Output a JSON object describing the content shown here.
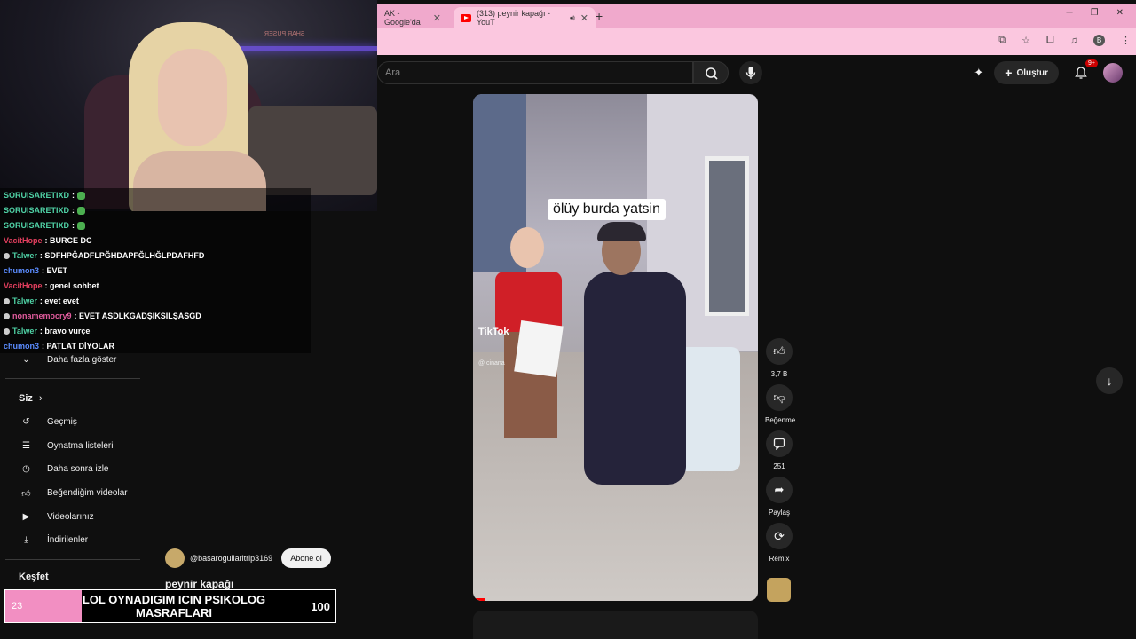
{
  "browser": {
    "tabs": [
      {
        "title": "AK - Google'da"
      },
      {
        "title": "(313) peynir kapağı - YouT"
      }
    ],
    "new_tab": "+",
    "profile_letter": "B"
  },
  "header": {
    "search_placeholder": "Ara",
    "create_label": "Oluştur",
    "notif_count": "9+"
  },
  "chat": {
    "messages": [
      {
        "user": "SORUISARETIXD",
        "text": ":",
        "color": "#4fd1a5",
        "emote": true
      },
      {
        "user": "SORUISARETIXD",
        "text": ":",
        "color": "#4fd1a5",
        "emote": true
      },
      {
        "user": "SORUISARETIXD",
        "text": ":",
        "color": "#4fd1a5",
        "emote": true
      },
      {
        "user": "VacitHope",
        "text": ": BURCE DC",
        "color": "#e33f5e",
        "emote": false
      },
      {
        "user": "Talwer",
        "text": ": SDFHPĞADFLPĞHDAPFĞLHĞLPDAFHFD",
        "color": "#4fd1a5",
        "emote": false
      },
      {
        "user": "chumon3",
        "text": ": EVET",
        "color": "#5b8cff",
        "emote": false
      },
      {
        "user": "VacitHope",
        "text": ": genel sohbet",
        "color": "#e33f5e",
        "emote": false
      },
      {
        "user": "Talwer",
        "text": ": evet evet",
        "color": "#4fd1a5",
        "emote": false
      },
      {
        "user": "nonamemocry9",
        "text": ": EVET ASDLKGADŞIKSİLŞASGD",
        "color": "#e35c9e",
        "emote": false
      },
      {
        "user": "Talwer",
        "text": ": bravo vurçe",
        "color": "#4fd1a5",
        "emote": false
      },
      {
        "user": "chumon3",
        "text": ": PATLAT DİYOLAR",
        "color": "#5b8cff",
        "emote": false
      }
    ]
  },
  "sidebar": {
    "show_more": "Daha fazla göster",
    "you_header": "Siz",
    "items": [
      {
        "label": "Geçmiş",
        "icon": "history-icon"
      },
      {
        "label": "Oynatma listeleri",
        "icon": "playlist-icon"
      },
      {
        "label": "Daha sonra izle",
        "icon": "clock-icon"
      },
      {
        "label": "Beğendiğim videolar",
        "icon": "thumb-up-icon"
      },
      {
        "label": "Videolarınız",
        "icon": "video-icon"
      },
      {
        "label": "İndirilenler",
        "icon": "download-icon"
      }
    ],
    "explore_header": "Keşfet"
  },
  "video": {
    "caption": "ölüy burda yatsin",
    "watermark": "TikTok",
    "watermark_handle": "@ cinana",
    "channel": "@basarogullaritrip3169",
    "subscribe": "Abone ol",
    "title": "peynir kapağı",
    "progress_fraction": 0.04
  },
  "actions": {
    "likes": "3,7 B",
    "dislike": "Beğenme",
    "comments": "251",
    "share": "Paylaş",
    "remix": "Remix"
  },
  "goal": {
    "left": "23",
    "text": "LOL OYNADIGIM ICIN PSIKOLOG MASRAFLARI",
    "right": "100",
    "fill_fraction": 0.23,
    "color": "#f28fc2"
  },
  "webcam": {
    "sign": "SHAR PUSER"
  },
  "colors": {
    "browser_pink": "#f0a9cc",
    "yt_background": "#0f0f0f",
    "accent_red": "#ff0000"
  }
}
